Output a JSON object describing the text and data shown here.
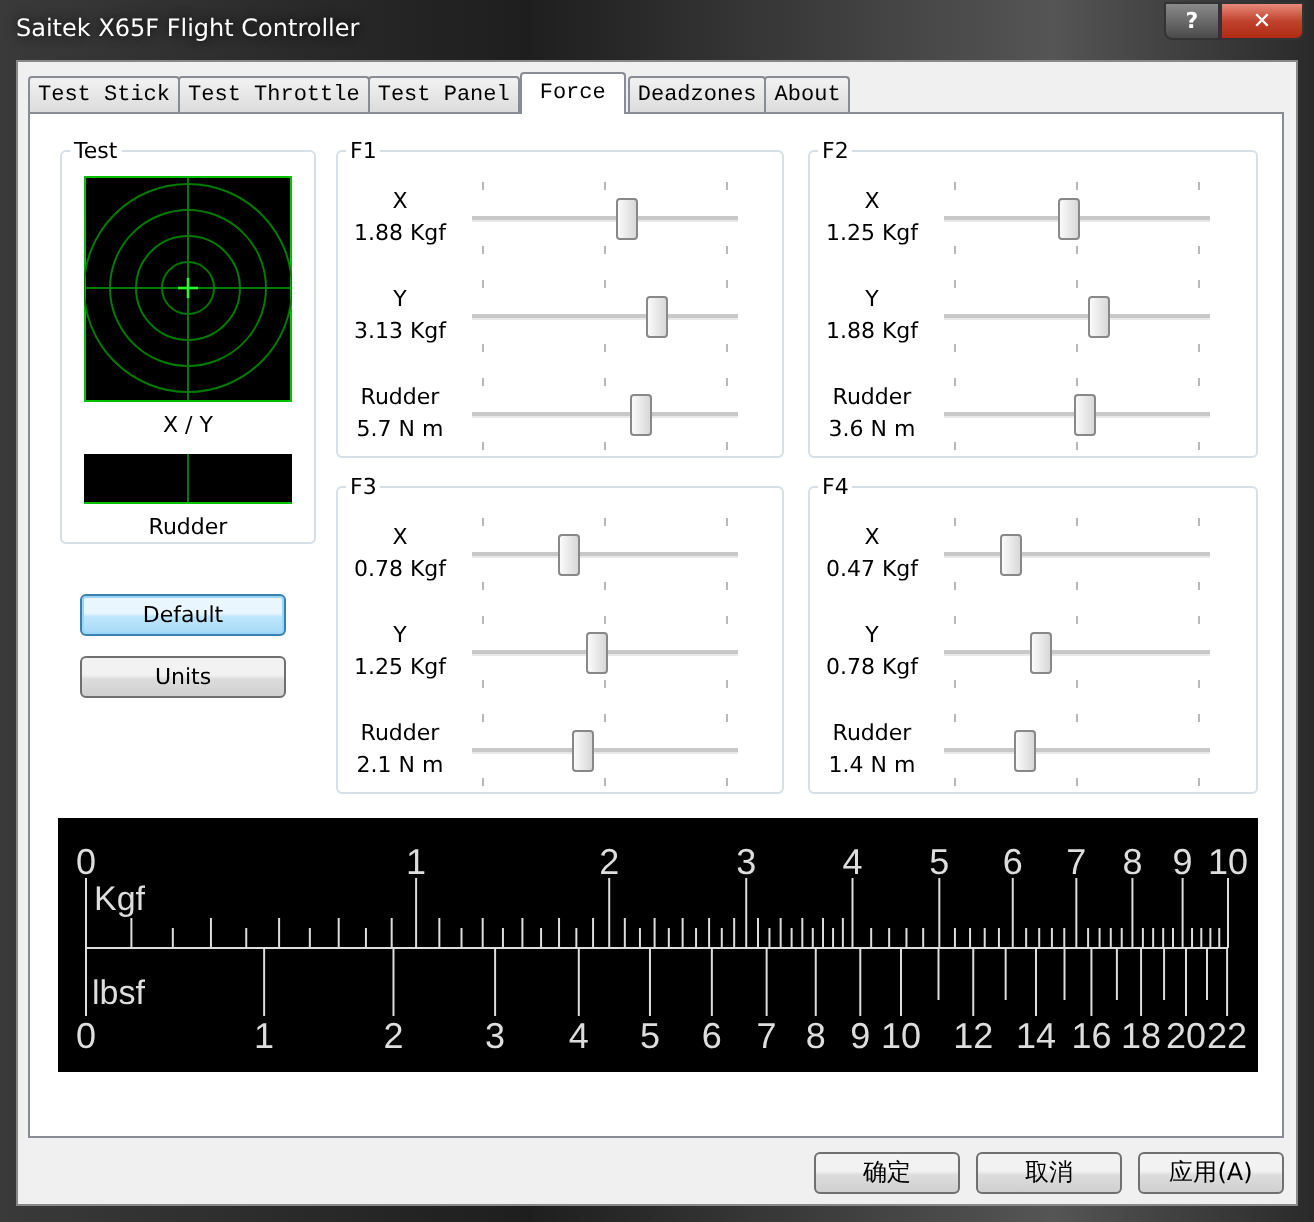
{
  "window": {
    "title": "Saitek X65F Flight Controller",
    "help": "?",
    "close": "✕"
  },
  "tabs": [
    {
      "label": "Test Stick",
      "selected": false
    },
    {
      "label": "Test Throttle",
      "selected": false
    },
    {
      "label": "Test Panel",
      "selected": false
    },
    {
      "label": "Force",
      "selected": true
    },
    {
      "label": "Deadzones",
      "selected": false
    },
    {
      "label": "About",
      "selected": false
    }
  ],
  "test_group": {
    "title": "Test",
    "xy_label": "X / Y",
    "rudder_label": "Rudder"
  },
  "side_buttons": [
    {
      "label": "Default",
      "focused": true
    },
    {
      "label": "Units",
      "focused": false
    }
  ],
  "force_groups": [
    {
      "title": "F1",
      "axes": [
        {
          "name": "X",
          "reading": "1.88 Kgf",
          "level": 0.59
        },
        {
          "name": "Y",
          "reading": "3.13 Kgf",
          "level": 0.71
        },
        {
          "name": "Rudder",
          "reading": "5.7 N m",
          "level": 0.65
        }
      ]
    },
    {
      "title": "F2",
      "axes": [
        {
          "name": "X",
          "reading": "1.25 Kgf",
          "level": 0.47
        },
        {
          "name": "Y",
          "reading": "1.88 Kgf",
          "level": 0.59
        },
        {
          "name": "Rudder",
          "reading": "3.6 N m",
          "level": 0.53
        }
      ]
    },
    {
      "title": "F3",
      "axes": [
        {
          "name": "X",
          "reading": "0.78 Kgf",
          "level": 0.35
        },
        {
          "name": "Y",
          "reading": "1.25 Kgf",
          "level": 0.47
        },
        {
          "name": "Rudder",
          "reading": "2.1 N m",
          "level": 0.41
        }
      ]
    },
    {
      "title": "F4",
      "axes": [
        {
          "name": "X",
          "reading": "0.47 Kgf",
          "level": 0.23
        },
        {
          "name": "Y",
          "reading": "0.78 Kgf",
          "level": 0.35
        },
        {
          "name": "Rudder",
          "reading": "1.4 N m",
          "level": 0.29
        }
      ]
    }
  ],
  "scale": {
    "upper_unit": "Kgf",
    "lower_unit": "lbsf",
    "upper_labels": [
      "0",
      "1",
      "2",
      "3",
      "4",
      "5",
      "6",
      "7",
      "8",
      "9",
      "10"
    ],
    "lower_labels": [
      "0",
      "1",
      "2",
      "3",
      "4",
      "5",
      "6",
      "7",
      "8",
      "9",
      "10",
      "12",
      "14",
      "16",
      "18",
      "20",
      "22"
    ]
  },
  "buttons": [
    {
      "label": "确定"
    },
    {
      "label": "取消"
    },
    {
      "label": "应用(A)"
    }
  ]
}
